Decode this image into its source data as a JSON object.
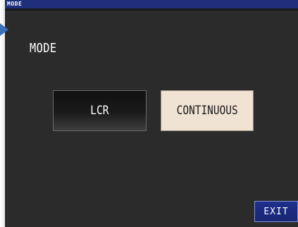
{
  "window": {
    "title": "MODE"
  },
  "main": {
    "heading": "MODE",
    "mode_options": [
      {
        "label": "LCR",
        "selected": false
      },
      {
        "label": "CONTINUOUS",
        "selected": true
      }
    ]
  },
  "footer": {
    "exit_label": "EXIT"
  },
  "colors": {
    "titlebar": "#1f2f7a",
    "screen_background": "#2b2b2b",
    "selected_button": "#f1e3d3",
    "exit_button": "#1e2f8c",
    "pointer_arrow": "#3b6fb6"
  },
  "icons": {
    "pointer": "pointer-arrow-icon"
  }
}
